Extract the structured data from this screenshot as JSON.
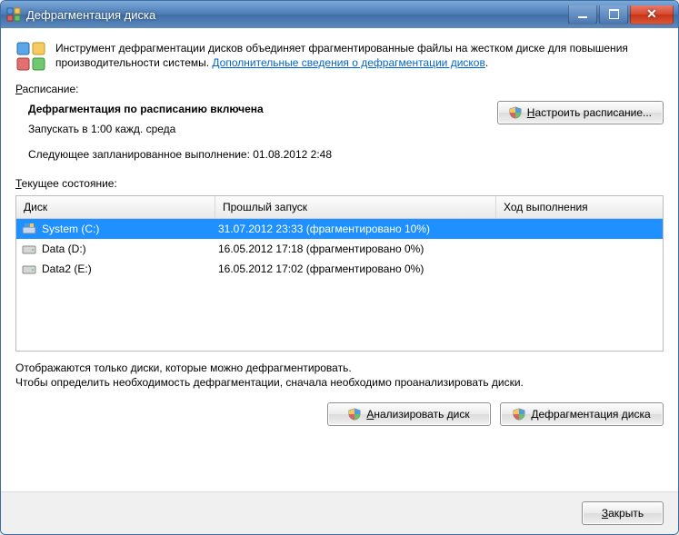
{
  "window": {
    "title": "Дефрагментация диска"
  },
  "intro": {
    "text_part1": "Инструмент дефрагментации дисков объединяет фрагментированные файлы на жестком диске для повышения производительности системы. ",
    "link_text": "Дополнительные сведения о дефрагментации дисков",
    "link_suffix": "."
  },
  "schedule": {
    "section_label_prefix": "Р",
    "section_label_rest": "асписание:",
    "enabled_text": "Дефрагментация по расписанию включена",
    "run_at": "Запускать в 1:00 кажд. среда",
    "next_run": "Следующее запланированное выполнение: 01.08.2012 2:48",
    "button_prefix": "Н",
    "button_rest": "астроить расписание..."
  },
  "current": {
    "label_prefix": "Т",
    "label_rest": "екущее состояние:",
    "columns": {
      "disk": "Диск",
      "last_run": "Прошлый запуск",
      "progress": "Ход выполнения"
    },
    "rows": [
      {
        "name": "System (C:)",
        "last": "31.07.2012 23:33 (фрагментировано 10%)",
        "selected": true,
        "icon": "system"
      },
      {
        "name": "Data (D:)",
        "last": "16.05.2012 17:18 (фрагментировано 0%)",
        "selected": false,
        "icon": "hdd"
      },
      {
        "name": "Data2 (E:)",
        "last": "16.05.2012 17:02 (фрагментировано 0%)",
        "selected": false,
        "icon": "hdd"
      }
    ]
  },
  "hints": {
    "line1": "Отображаются только диски, которые можно дефрагментировать.",
    "line2": "Чтобы определить необходимость дефрагментации, сначала необходимо проанализировать диски."
  },
  "actions": {
    "analyze_prefix": "А",
    "analyze_rest": "нализировать диск",
    "defrag_prefix": "Д",
    "defrag_rest": "ефрагментация диска",
    "close_prefix": "З",
    "close_rest": "акрыть"
  }
}
